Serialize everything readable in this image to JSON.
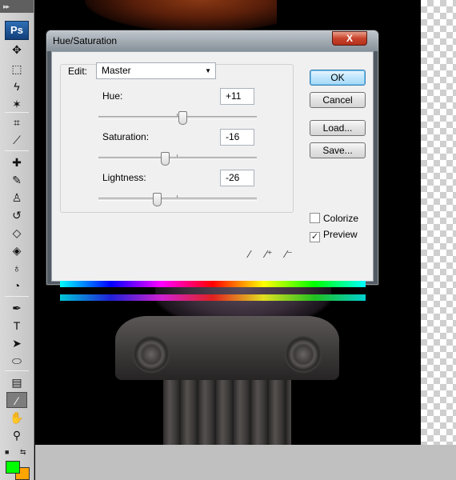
{
  "app": {
    "logo_text": "Ps",
    "toolbar_grip": "▸▸"
  },
  "colors": {
    "foreground": "#00ff00",
    "background": "#ffa500"
  },
  "dialog": {
    "title": "Hue/Saturation",
    "close_label": "X",
    "edit": {
      "label": "Edit:",
      "selected": "Master"
    },
    "sliders": [
      {
        "name": "hue",
        "label": "Hue:",
        "value": "+11",
        "range": [
          -180,
          180
        ]
      },
      {
        "name": "saturation",
        "label": "Saturation:",
        "value": "-16",
        "range": [
          -100,
          100
        ]
      },
      {
        "name": "lightness",
        "label": "Lightness:",
        "value": "-26",
        "range": [
          -100,
          100
        ]
      }
    ],
    "buttons": {
      "ok": "OK",
      "cancel": "Cancel",
      "load": "Load...",
      "save": "Save..."
    },
    "checkboxes": {
      "colorize": {
        "label": "Colorize",
        "checked": false
      },
      "preview": {
        "label": "Preview",
        "checked": true
      }
    },
    "eyedroppers": [
      "eyedropper-icon",
      "eyedropper-plus-icon",
      "eyedropper-minus-icon"
    ]
  },
  "tools": [
    "move-tool-icon",
    "marquee-tool-icon",
    "lasso-tool-icon",
    "magic-wand-tool-icon",
    "crop-tool-icon",
    "slice-tool-icon",
    "healing-brush-tool-icon",
    "brush-tool-icon",
    "clone-stamp-tool-icon",
    "history-brush-tool-icon",
    "eraser-tool-icon",
    "paint-bucket-tool-icon",
    "blur-tool-icon",
    "dodge-tool-icon",
    "pen-tool-icon",
    "type-tool-icon",
    "path-selection-tool-icon",
    "shape-tool-icon",
    "notes-tool-icon",
    "eyedropper-tool-icon",
    "hand-tool-icon",
    "zoom-tool-icon"
  ]
}
